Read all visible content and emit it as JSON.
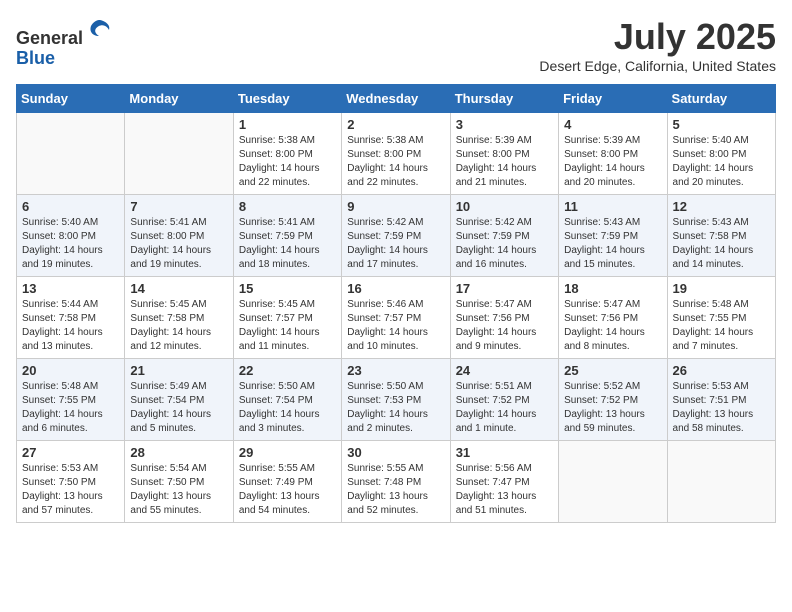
{
  "header": {
    "logo_line1": "General",
    "logo_line2": "Blue",
    "month_title": "July 2025",
    "location": "Desert Edge, California, United States"
  },
  "days_of_week": [
    "Sunday",
    "Monday",
    "Tuesday",
    "Wednesday",
    "Thursday",
    "Friday",
    "Saturday"
  ],
  "weeks": [
    [
      {
        "day": "",
        "info": ""
      },
      {
        "day": "",
        "info": ""
      },
      {
        "day": "1",
        "info": "Sunrise: 5:38 AM\nSunset: 8:00 PM\nDaylight: 14 hours and 22 minutes."
      },
      {
        "day": "2",
        "info": "Sunrise: 5:38 AM\nSunset: 8:00 PM\nDaylight: 14 hours and 22 minutes."
      },
      {
        "day": "3",
        "info": "Sunrise: 5:39 AM\nSunset: 8:00 PM\nDaylight: 14 hours and 21 minutes."
      },
      {
        "day": "4",
        "info": "Sunrise: 5:39 AM\nSunset: 8:00 PM\nDaylight: 14 hours and 20 minutes."
      },
      {
        "day": "5",
        "info": "Sunrise: 5:40 AM\nSunset: 8:00 PM\nDaylight: 14 hours and 20 minutes."
      }
    ],
    [
      {
        "day": "6",
        "info": "Sunrise: 5:40 AM\nSunset: 8:00 PM\nDaylight: 14 hours and 19 minutes."
      },
      {
        "day": "7",
        "info": "Sunrise: 5:41 AM\nSunset: 8:00 PM\nDaylight: 14 hours and 19 minutes."
      },
      {
        "day": "8",
        "info": "Sunrise: 5:41 AM\nSunset: 7:59 PM\nDaylight: 14 hours and 18 minutes."
      },
      {
        "day": "9",
        "info": "Sunrise: 5:42 AM\nSunset: 7:59 PM\nDaylight: 14 hours and 17 minutes."
      },
      {
        "day": "10",
        "info": "Sunrise: 5:42 AM\nSunset: 7:59 PM\nDaylight: 14 hours and 16 minutes."
      },
      {
        "day": "11",
        "info": "Sunrise: 5:43 AM\nSunset: 7:59 PM\nDaylight: 14 hours and 15 minutes."
      },
      {
        "day": "12",
        "info": "Sunrise: 5:43 AM\nSunset: 7:58 PM\nDaylight: 14 hours and 14 minutes."
      }
    ],
    [
      {
        "day": "13",
        "info": "Sunrise: 5:44 AM\nSunset: 7:58 PM\nDaylight: 14 hours and 13 minutes."
      },
      {
        "day": "14",
        "info": "Sunrise: 5:45 AM\nSunset: 7:58 PM\nDaylight: 14 hours and 12 minutes."
      },
      {
        "day": "15",
        "info": "Sunrise: 5:45 AM\nSunset: 7:57 PM\nDaylight: 14 hours and 11 minutes."
      },
      {
        "day": "16",
        "info": "Sunrise: 5:46 AM\nSunset: 7:57 PM\nDaylight: 14 hours and 10 minutes."
      },
      {
        "day": "17",
        "info": "Sunrise: 5:47 AM\nSunset: 7:56 PM\nDaylight: 14 hours and 9 minutes."
      },
      {
        "day": "18",
        "info": "Sunrise: 5:47 AM\nSunset: 7:56 PM\nDaylight: 14 hours and 8 minutes."
      },
      {
        "day": "19",
        "info": "Sunrise: 5:48 AM\nSunset: 7:55 PM\nDaylight: 14 hours and 7 minutes."
      }
    ],
    [
      {
        "day": "20",
        "info": "Sunrise: 5:48 AM\nSunset: 7:55 PM\nDaylight: 14 hours and 6 minutes."
      },
      {
        "day": "21",
        "info": "Sunrise: 5:49 AM\nSunset: 7:54 PM\nDaylight: 14 hours and 5 minutes."
      },
      {
        "day": "22",
        "info": "Sunrise: 5:50 AM\nSunset: 7:54 PM\nDaylight: 14 hours and 3 minutes."
      },
      {
        "day": "23",
        "info": "Sunrise: 5:50 AM\nSunset: 7:53 PM\nDaylight: 14 hours and 2 minutes."
      },
      {
        "day": "24",
        "info": "Sunrise: 5:51 AM\nSunset: 7:52 PM\nDaylight: 14 hours and 1 minute."
      },
      {
        "day": "25",
        "info": "Sunrise: 5:52 AM\nSunset: 7:52 PM\nDaylight: 13 hours and 59 minutes."
      },
      {
        "day": "26",
        "info": "Sunrise: 5:53 AM\nSunset: 7:51 PM\nDaylight: 13 hours and 58 minutes."
      }
    ],
    [
      {
        "day": "27",
        "info": "Sunrise: 5:53 AM\nSunset: 7:50 PM\nDaylight: 13 hours and 57 minutes."
      },
      {
        "day": "28",
        "info": "Sunrise: 5:54 AM\nSunset: 7:50 PM\nDaylight: 13 hours and 55 minutes."
      },
      {
        "day": "29",
        "info": "Sunrise: 5:55 AM\nSunset: 7:49 PM\nDaylight: 13 hours and 54 minutes."
      },
      {
        "day": "30",
        "info": "Sunrise: 5:55 AM\nSunset: 7:48 PM\nDaylight: 13 hours and 52 minutes."
      },
      {
        "day": "31",
        "info": "Sunrise: 5:56 AM\nSunset: 7:47 PM\nDaylight: 13 hours and 51 minutes."
      },
      {
        "day": "",
        "info": ""
      },
      {
        "day": "",
        "info": ""
      }
    ]
  ]
}
